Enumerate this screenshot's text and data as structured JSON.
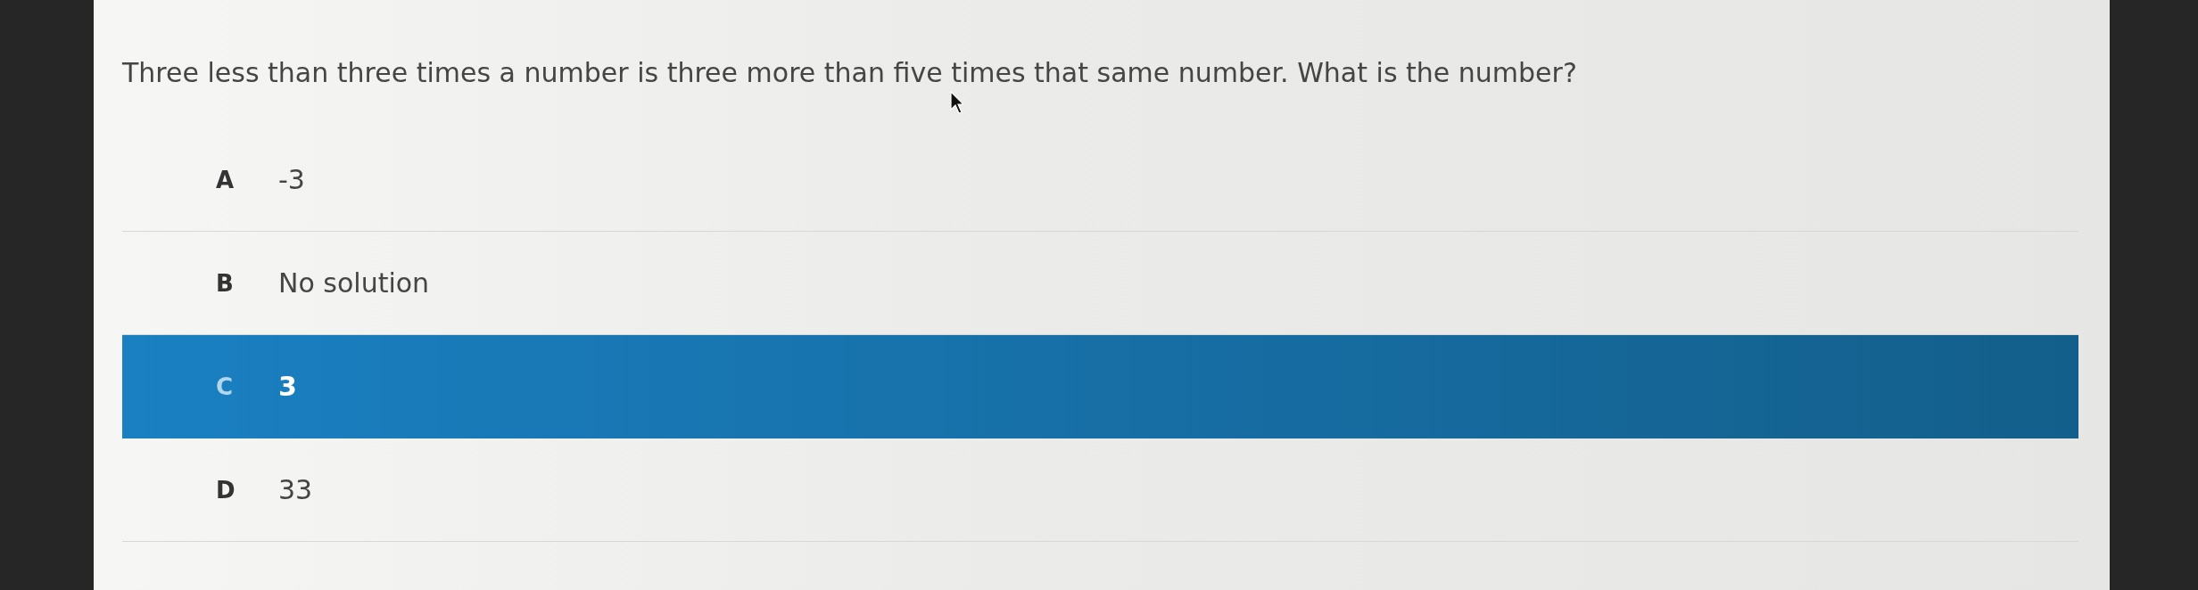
{
  "question": "Three less than three times a number is three more than five times that same number. What is the number?",
  "options": [
    {
      "letter": "A",
      "text": "-3",
      "selected": false
    },
    {
      "letter": "B",
      "text": "No solution",
      "selected": false
    },
    {
      "letter": "C",
      "text": "3",
      "selected": true
    },
    {
      "letter": "D",
      "text": "33",
      "selected": false
    }
  ]
}
